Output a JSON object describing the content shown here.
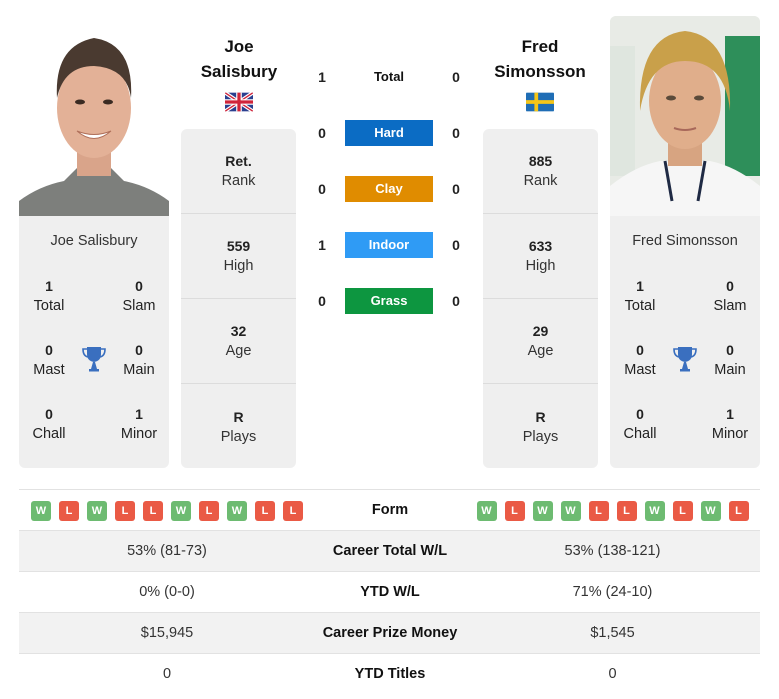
{
  "colors": {
    "hard": "#0b6cc4",
    "clay": "#e08c00",
    "indoor": "#2f9bf5",
    "grass": "#0d9640",
    "win": "#6dbb71",
    "loss": "#ea5a45",
    "trophy": "#3a6fbf"
  },
  "player1": {
    "name_line1": "Joe",
    "name_line2": "Salisbury",
    "full_name": "Joe Salisbury",
    "country_flag": "uk-flag-icon",
    "stats": [
      {
        "value": "Ret.",
        "label": "Rank"
      },
      {
        "value": "559",
        "label": "High"
      },
      {
        "value": "32",
        "label": "Age"
      },
      {
        "value": "R",
        "label": "Plays"
      }
    ],
    "titles": {
      "total": {
        "value": "1",
        "label": "Total"
      },
      "slam": {
        "value": "0",
        "label": "Slam"
      },
      "mast": {
        "value": "0",
        "label": "Mast"
      },
      "main": {
        "value": "0",
        "label": "Main"
      },
      "chall": {
        "value": "0",
        "label": "Chall"
      },
      "minor": {
        "value": "1",
        "label": "Minor"
      }
    },
    "form": [
      "W",
      "L",
      "W",
      "L",
      "L",
      "W",
      "L",
      "W",
      "L",
      "L"
    ]
  },
  "player2": {
    "name_line1": "Fred",
    "name_line2": "Simonsson",
    "full_name": "Fred Simonsson",
    "country_flag": "sweden-flag-icon",
    "stats": [
      {
        "value": "885",
        "label": "Rank"
      },
      {
        "value": "633",
        "label": "High"
      },
      {
        "value": "29",
        "label": "Age"
      },
      {
        "value": "R",
        "label": "Plays"
      }
    ],
    "titles": {
      "total": {
        "value": "1",
        "label": "Total"
      },
      "slam": {
        "value": "0",
        "label": "Slam"
      },
      "mast": {
        "value": "0",
        "label": "Mast"
      },
      "main": {
        "value": "0",
        "label": "Main"
      },
      "chall": {
        "value": "0",
        "label": "Chall"
      },
      "minor": {
        "value": "1",
        "label": "Minor"
      }
    },
    "form": [
      "W",
      "L",
      "W",
      "W",
      "L",
      "L",
      "W",
      "L",
      "W",
      "L"
    ]
  },
  "h2h": [
    {
      "label": "Total",
      "left": "1",
      "right": "0"
    },
    {
      "label": "Hard",
      "left": "0",
      "right": "0"
    },
    {
      "label": "Clay",
      "left": "0",
      "right": "0"
    },
    {
      "label": "Indoor",
      "left": "1",
      "right": "0"
    },
    {
      "label": "Grass",
      "left": "0",
      "right": "0"
    }
  ],
  "comparison": {
    "form_label": "Form",
    "rows": [
      {
        "label": "Career Total W/L",
        "left": "53% (81-73)",
        "right": "53% (138-121)"
      },
      {
        "label": "YTD W/L",
        "left": "0% (0-0)",
        "right": "71% (24-10)"
      },
      {
        "label": "Career Prize Money",
        "left": "$15,945",
        "right": "$1,545"
      },
      {
        "label": "YTD Titles",
        "left": "0",
        "right": "0"
      }
    ]
  }
}
